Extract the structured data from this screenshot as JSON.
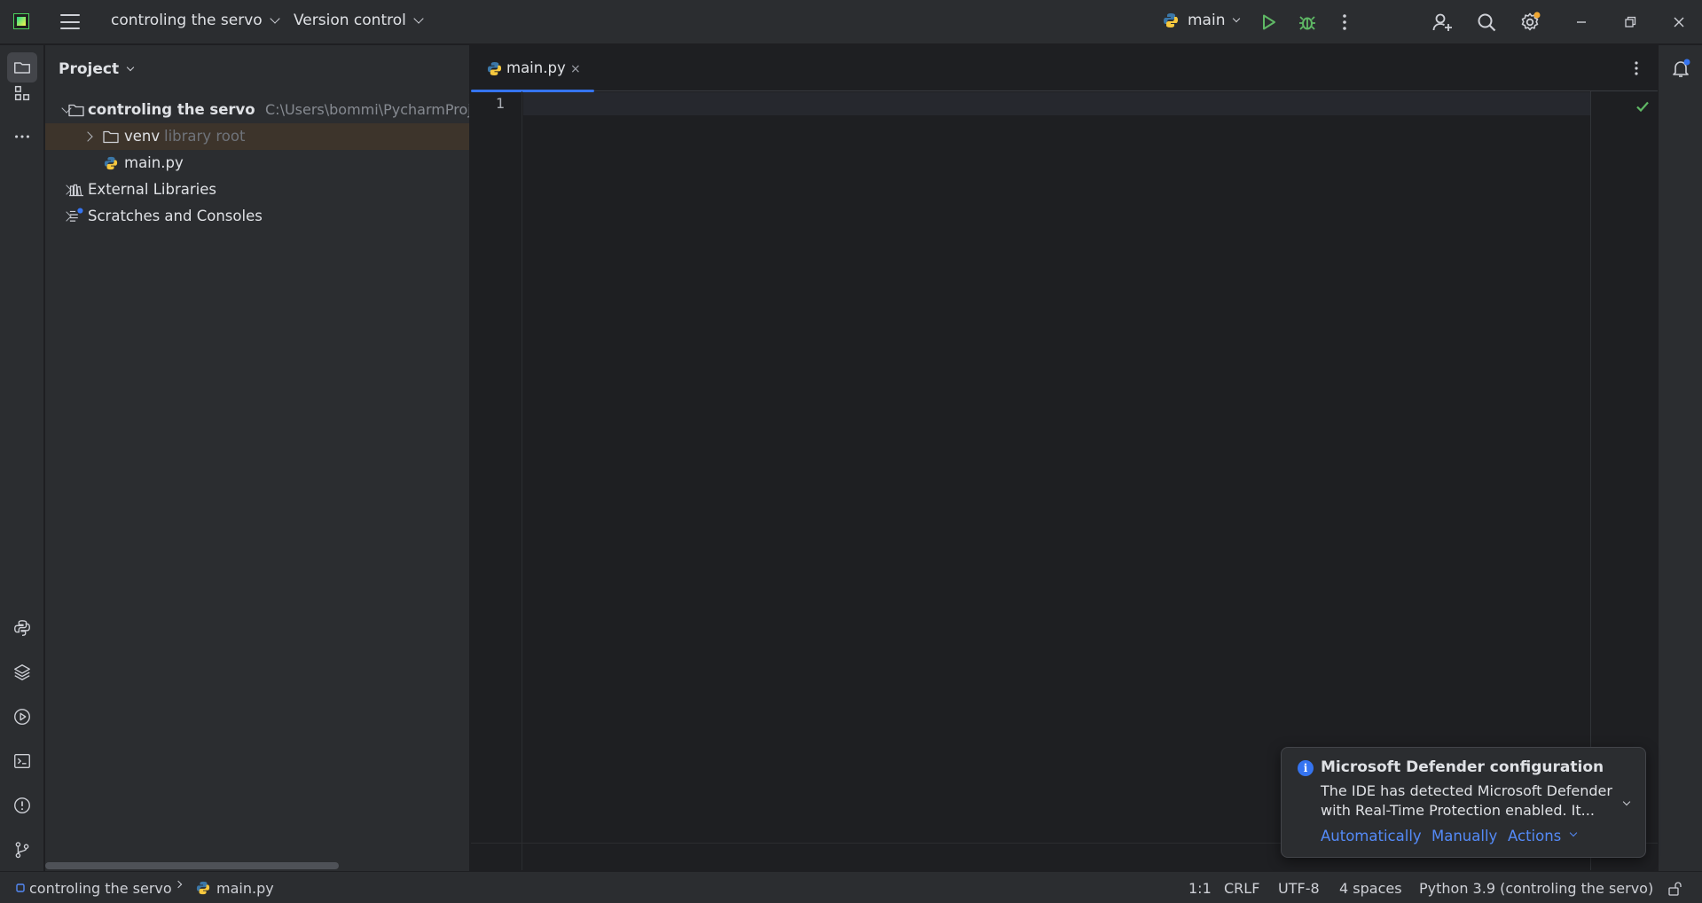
{
  "titlebar": {
    "project_name": "controling the servo",
    "vcs_label": "Version control",
    "run_config": "main"
  },
  "project_panel": {
    "header": "Project",
    "root": {
      "name": "controling the servo",
      "path": "C:\\Users\\bommi\\PycharmProje"
    },
    "items": [
      {
        "name": "venv",
        "hint": "library root"
      },
      {
        "name": "main.py"
      },
      {
        "name": "External Libraries"
      },
      {
        "name": "Scratches and Consoles"
      }
    ]
  },
  "editor": {
    "tab_label": "main.py",
    "tab_close": "×",
    "line_numbers": [
      "1"
    ]
  },
  "notification": {
    "icon": "i",
    "title": "Microsoft Defender configuration",
    "body": "The IDE has detected Microsoft Defender with Real-Time Protection enabled. It...",
    "actions": [
      "Automatically",
      "Manually",
      "Actions"
    ]
  },
  "statusbar": {
    "breadcrumb_project": "controling the servo",
    "breadcrumb_file": "main.py",
    "caret": "1:1",
    "line_sep": "CRLF",
    "encoding": "UTF-8",
    "indent": "4 spaces",
    "interpreter": "Python 3.9 (controling the servo)"
  },
  "colors": {
    "accent": "#3574f0",
    "run_green": "#5fb865",
    "notification_badge": "#f0a732"
  }
}
